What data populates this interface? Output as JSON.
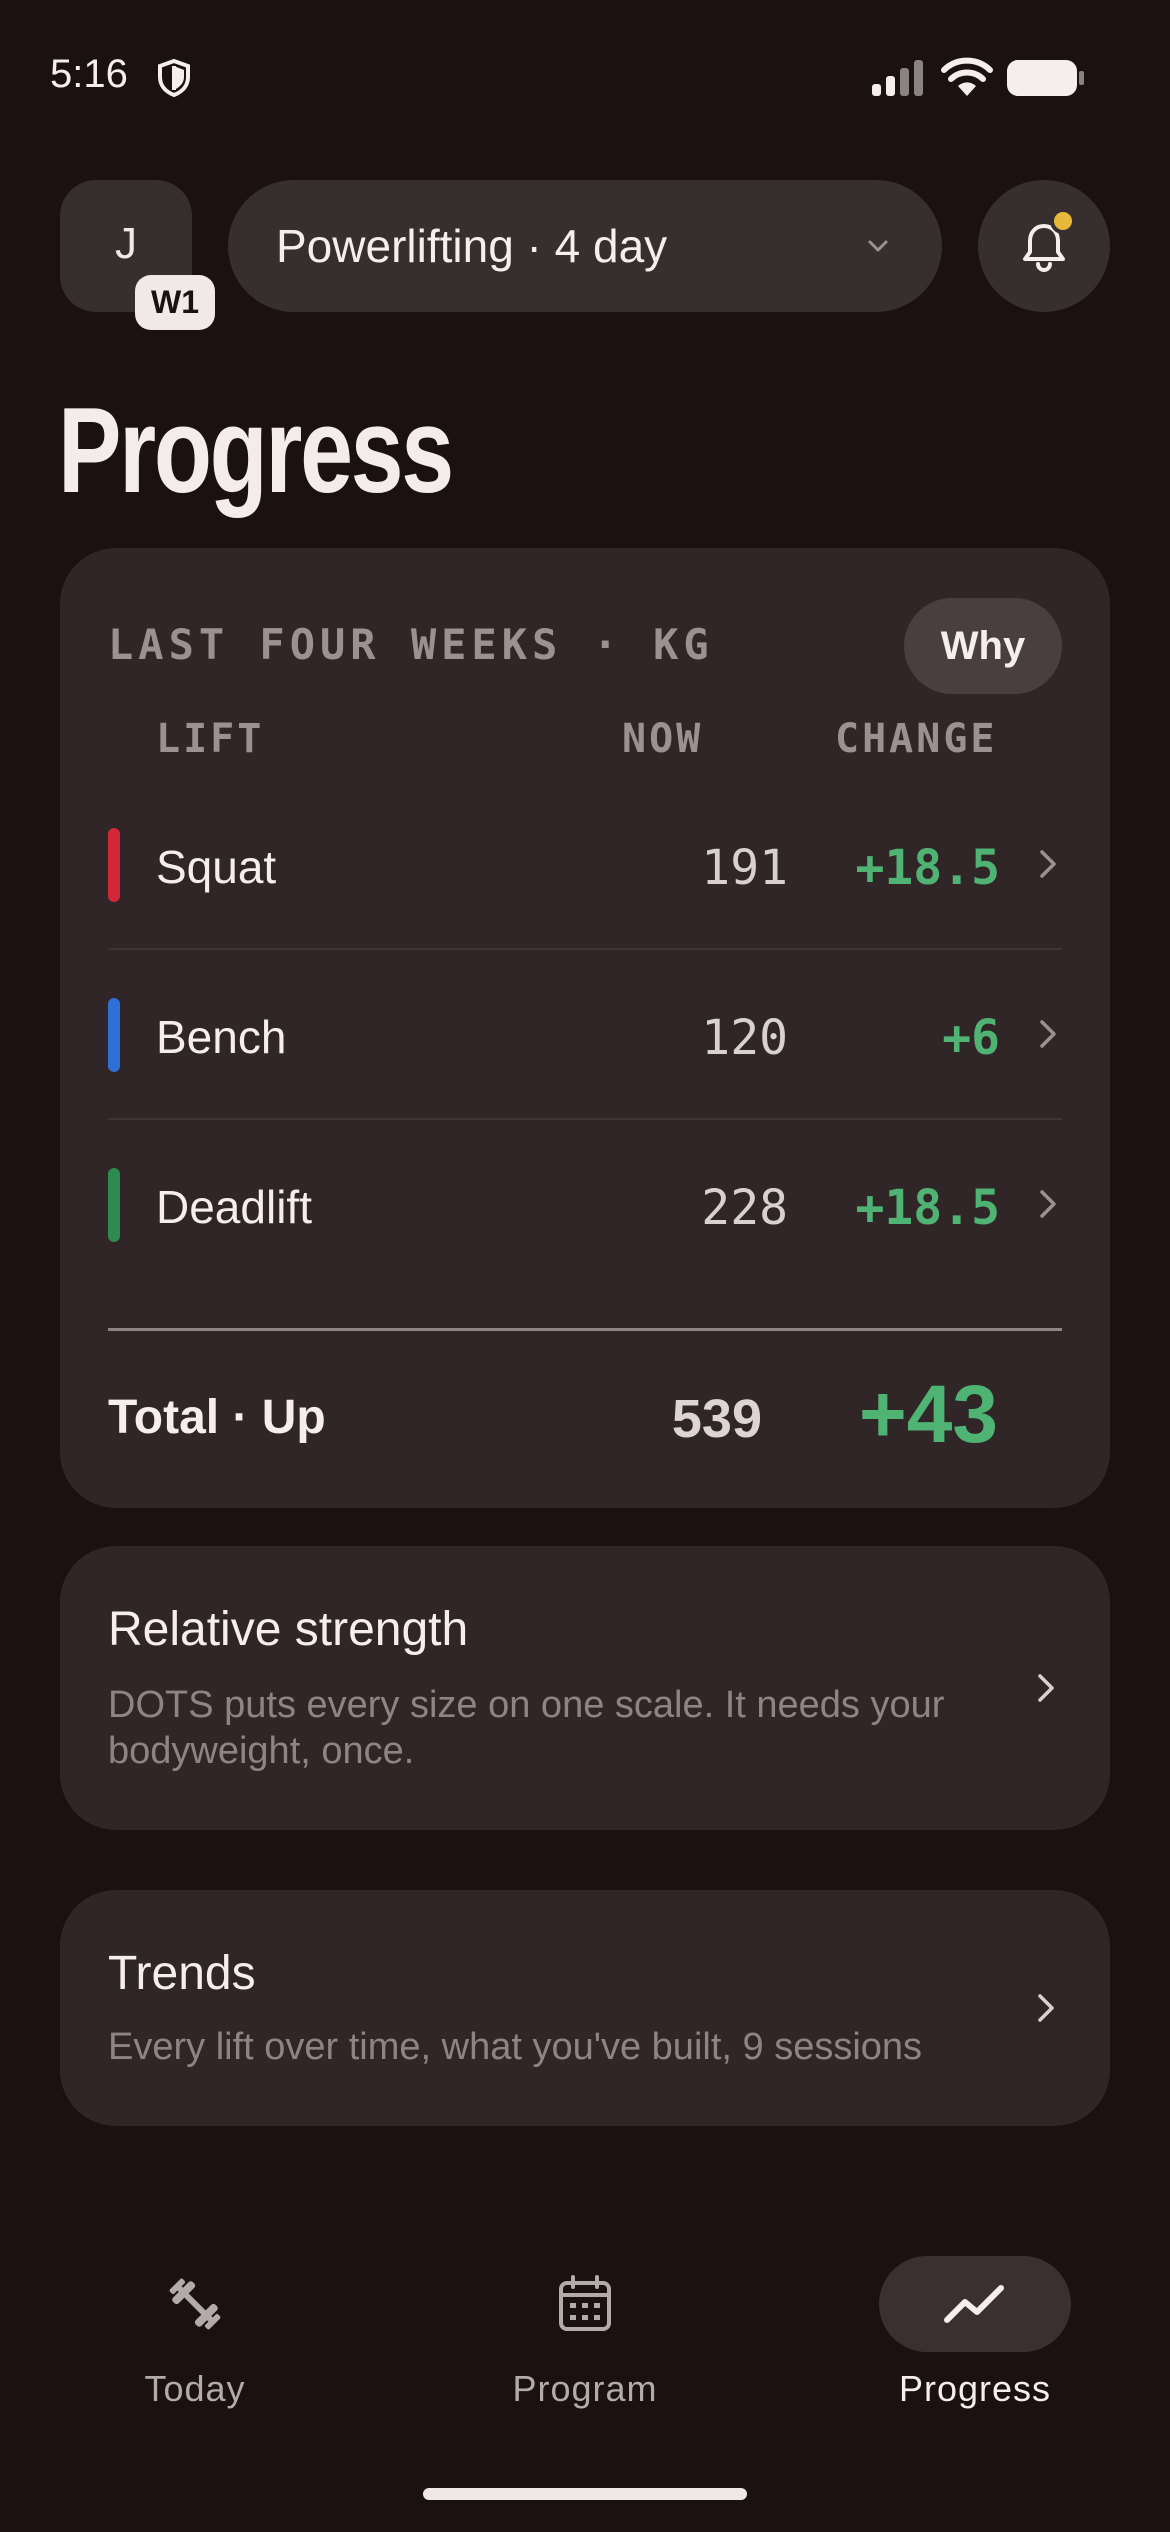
{
  "status_bar": {
    "time": "5:16"
  },
  "header": {
    "avatar_initial": "J",
    "week_badge": "W1",
    "program_name": "Powerlifting · 4 day",
    "notification_dot_color": "#e8b83a"
  },
  "page_title": "Progress",
  "summary_card": {
    "eyebrow": "LAST FOUR WEEKS · KG",
    "why_label": "Why",
    "columns": {
      "lift": "LIFT",
      "now": "NOW",
      "change": "CHANGE"
    },
    "lifts": [
      {
        "name": "Squat",
        "now": "191",
        "change": "+18.5",
        "color": "#d32839"
      },
      {
        "name": "Bench",
        "now": "120",
        "change": "+6",
        "color": "#2f6fd6"
      },
      {
        "name": "Deadlift",
        "now": "228",
        "change": "+18.5",
        "color": "#2e8a4f"
      }
    ],
    "total": {
      "label": "Total · Up",
      "now": "539",
      "change": "+43"
    },
    "positive_color": "#4fb374"
  },
  "relative_strength": {
    "title": "Relative strength",
    "subtitle": "DOTS puts every size on one scale. It needs your bodyweight, once."
  },
  "trends": {
    "title": "Trends",
    "subtitle": "Every lift over time, what you've built, 9 sessions"
  },
  "bottom_nav": {
    "items": [
      {
        "label": "Today",
        "icon": "barbell-icon"
      },
      {
        "label": "Program",
        "icon": "calendar-icon"
      },
      {
        "label": "Progress",
        "icon": "trend-line-icon",
        "active": true
      }
    ]
  }
}
